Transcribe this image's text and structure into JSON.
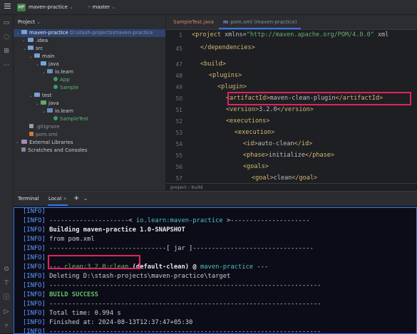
{
  "titlebar": {
    "project_badge": "MP",
    "project_name": "maven-practice",
    "branch": "master"
  },
  "project_panel": {
    "header": "Project",
    "rows": [
      {
        "name": "maven-practice",
        "extra": "D:\\stash-projects\\maven-practice"
      },
      {
        "name": ".idea"
      },
      {
        "name": "src"
      },
      {
        "name": "main"
      },
      {
        "name": "java"
      },
      {
        "name": "io.learn"
      },
      {
        "name": "App"
      },
      {
        "name": "Sample"
      },
      {
        "name": "test"
      },
      {
        "name": "java"
      },
      {
        "name": "io.learn"
      },
      {
        "name": "SampleTest"
      },
      {
        "name": ".gitignore"
      },
      {
        "name": "pom.xml"
      },
      {
        "name": "External Libraries"
      },
      {
        "name": "Scratches and Consoles"
      }
    ]
  },
  "editor": {
    "tabs": [
      {
        "label": "SampleTest.java"
      },
      {
        "label": "pom.xml (maven-practice)",
        "icon": "m"
      }
    ],
    "line_numbers": [
      "1",
      "45",
      "47",
      "48",
      "49",
      "50",
      "51",
      "52",
      "53",
      "54",
      "55",
      "56",
      "57"
    ],
    "lines": {
      "l1_a": "<project ",
      "l1_b": "xmlns",
      "l1_c": "=",
      "l1_d": "\"http://maven.apache.org/POM/4.0.0\"",
      "l1_e": " xml",
      "l45": "</dependencies>",
      "l47": "<build>",
      "l48": "<plugins>",
      "l49": "<plugin>",
      "l50_a": "<artifactId>",
      "l50_b": "maven-clean-plugin",
      "l50_c": "</artifactId>",
      "l51_a": "<version>",
      "l51_b": "3.2.0",
      "l51_c": "</version>",
      "l52": "<executions>",
      "l53": "<execution>",
      "l54_a": "<id>",
      "l54_b": "auto-clean",
      "l54_c": "</id>",
      "l55_a": "<phase>",
      "l55_b": "initialize",
      "l55_c": "</phase>",
      "l56": "<goals>",
      "l57_a": "<goal>",
      "l57_b": "clean",
      "l57_c": "</goal>"
    },
    "breadcrumb": [
      "project",
      "build"
    ]
  },
  "terminal": {
    "tab_label": "Terminal",
    "session_label": "Local",
    "lines": {
      "t1": "[INFO]",
      "t2_a": "[INFO] ",
      "t2_b": "---------------------< ",
      "t2_c": "io.learn:maven-practice",
      "t2_d": " >---------------------",
      "t3_a": "[INFO] ",
      "t3_b": "Building maven-practice 1.0-SNAPSHOT",
      "t4_a": "[INFO] ",
      "t4_b": "  from pom.xml",
      "t5_a": "[INFO] ",
      "t5_b": "-------------------------------[ jar ]--------------------------------",
      "t6": "[INFO]",
      "t7_a": "[INFO] ",
      "t7_b": "--- ",
      "t7_c": "clean:3.2.0:clean",
      "t7_d": " (default-clean) @ ",
      "t7_e": "maven-practice",
      "t7_f": " ---",
      "t8_a": "[INFO] ",
      "t8_b": "Deleting D:\\stash-projects\\maven-practice\\target",
      "t9_a": "[INFO] ",
      "t9_b": "------------------------------------------------------------------------",
      "t10_a": "[INFO] ",
      "t10_b": "BUILD SUCCESS",
      "t11_a": "[INFO] ",
      "t11_b": "------------------------------------------------------------------------",
      "t12_a": "[INFO] ",
      "t12_b": "Total time:  0.994 s",
      "t13_a": "[INFO] ",
      "t13_b": "Finished at: 2024-08-13T12:37:47+05:30",
      "t14_a": "[INFO] ",
      "t14_b": "------------------------------------------------------------------------"
    }
  },
  "colors": {
    "highlight_box": "#e0245e",
    "accent": "#3574f0",
    "success": "#63c163"
  }
}
